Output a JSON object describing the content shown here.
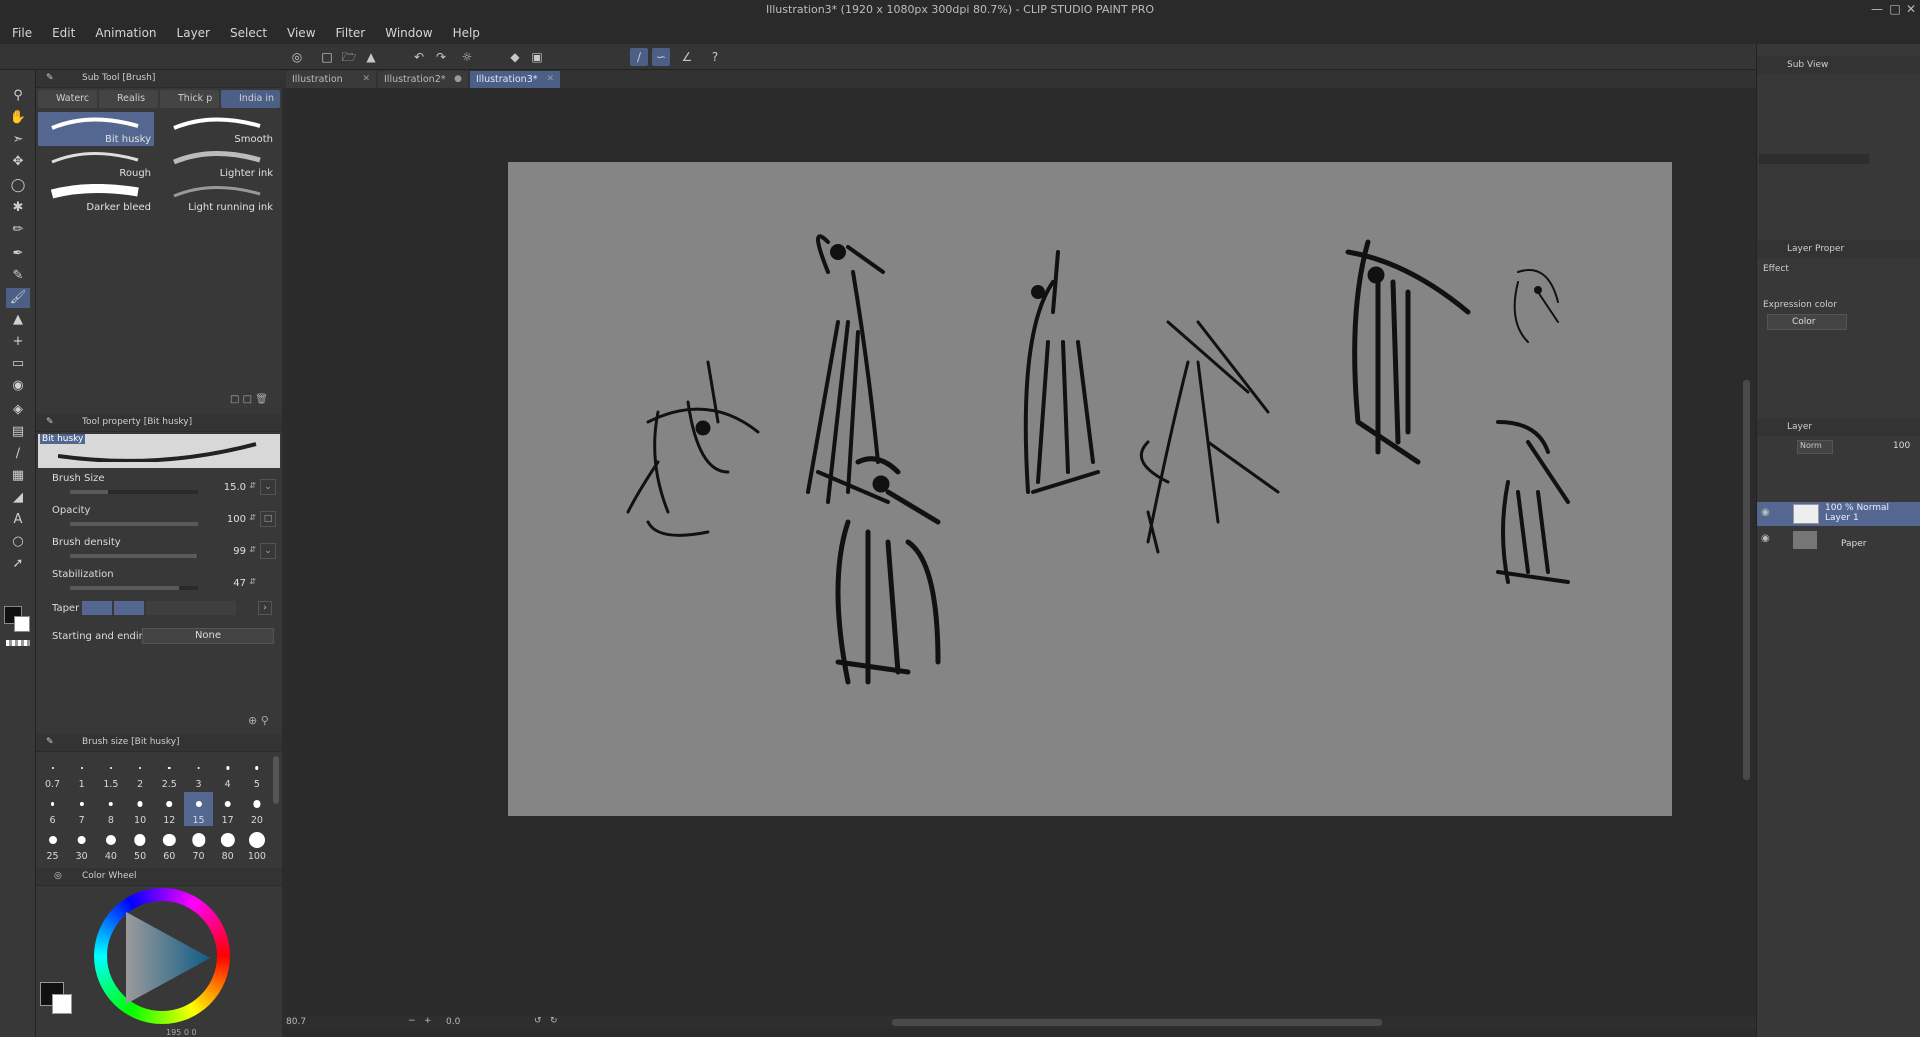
{
  "window": {
    "title": "Illustration3* (1920 x 1080px 300dpi 80.7%) - CLIP STUDIO PAINT PRO"
  },
  "menu": [
    "File",
    "Edit",
    "Animation",
    "Layer",
    "Select",
    "View",
    "Filter",
    "Window",
    "Help"
  ],
  "document_tabs": [
    {
      "label": "Illustration"
    },
    {
      "label": "Illustration2*"
    },
    {
      "label": "Illustration3*"
    }
  ],
  "subtool_panel": {
    "title": "Sub Tool [Brush]",
    "tabs": [
      "Waterc",
      "Realis",
      "Thick p",
      "India in"
    ],
    "brushes": [
      "Bit husky",
      "Smooth",
      "Rough",
      "Lighter ink",
      "Darker bleed",
      "Light running ink"
    ]
  },
  "tool_property": {
    "title": "Tool property [Bit husky]",
    "preview_label": "Bit husky",
    "brush_size": {
      "label": "Brush Size",
      "value": "15.0",
      "level": 0.3
    },
    "opacity": {
      "label": "Opacity",
      "value": "100",
      "level": 1.0
    },
    "brush_density": {
      "label": "Brush density",
      "value": "99",
      "level": 0.99
    },
    "stabilization": {
      "label": "Stabilization",
      "value": "47",
      "level": 0.85
    },
    "taper": {
      "label": "Taper"
    },
    "starting_ending": {
      "label": "Starting and ending",
      "value": "None"
    }
  },
  "brush_size_panel": {
    "title": "Brush size [Bit husky]",
    "sizes": [
      "0.7",
      "1",
      "1.5",
      "2",
      "2.5",
      "3",
      "4",
      "5",
      "6",
      "7",
      "8",
      "10",
      "12",
      "15",
      "17",
      "20",
      "25",
      "30",
      "40",
      "50",
      "60",
      "70",
      "80",
      "100"
    ],
    "selected": "15"
  },
  "color_panel": {
    "title": "Color Wheel",
    "main": "#111111",
    "sub": "#ffffff",
    "readout": "195 0 0"
  },
  "right_panels": {
    "subview": "Sub View",
    "layer_property": "Layer Proper",
    "effect_label": "Effect",
    "expression_color_label": "Expression color",
    "expression_color_value": "Color",
    "layer_panel": "Layer",
    "blend_mode": "Norm",
    "opacity_value": "100",
    "layers": [
      {
        "line1": "100 % Normal",
        "line2": "Layer 1"
      },
      {
        "line1": "",
        "line2": "Paper"
      }
    ]
  },
  "status": {
    "zoom": "80.7",
    "angle": "0.0"
  },
  "colors": {
    "accent": "#4c6087",
    "canvas": "#858585",
    "panel": "#383838"
  }
}
